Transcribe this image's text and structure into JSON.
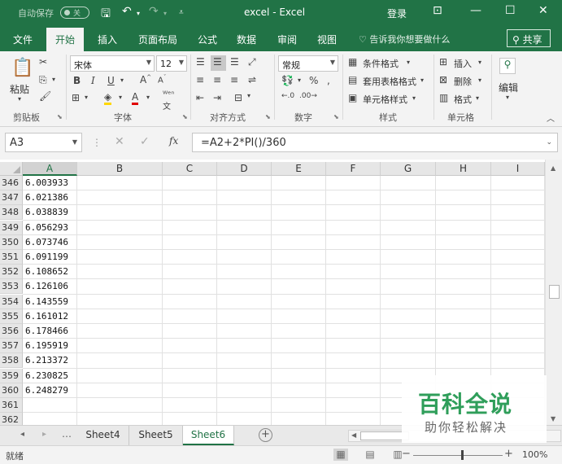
{
  "titlebar": {
    "autosave_label": "自动保存",
    "autosave_state": "关",
    "title": "excel  -  Excel",
    "login": "登录"
  },
  "tabs": [
    "文件",
    "开始",
    "插入",
    "页面布局",
    "公式",
    "数据",
    "审阅",
    "视图"
  ],
  "active_tab": "开始",
  "tellme": "告诉我你想要做什么",
  "share": "共享",
  "ribbon": {
    "paste": "粘贴",
    "clipboard": "剪贴板",
    "font_name": "宋体",
    "font_size": "12",
    "font_group": "字体",
    "align_group": "对齐方式",
    "number_format": "常规",
    "number_group": "数字",
    "cond_format": "条件格式",
    "table_format": "套用表格格式",
    "cell_style": "单元格样式",
    "style_group": "样式",
    "insert": "插入",
    "delete": "删除",
    "format": "格式",
    "cells_group": "单元格",
    "edit": "编辑"
  },
  "formula_bar": {
    "name_box": "A3",
    "formula": "=A2+2*PI()/360"
  },
  "columns": [
    "A",
    "B",
    "C",
    "D",
    "E",
    "F",
    "G",
    "H",
    "I"
  ],
  "rows": [
    {
      "n": "346",
      "a": "6.003933"
    },
    {
      "n": "347",
      "a": "6.021386"
    },
    {
      "n": "348",
      "a": "6.038839"
    },
    {
      "n": "349",
      "a": "6.056293"
    },
    {
      "n": "350",
      "a": "6.073746"
    },
    {
      "n": "351",
      "a": "6.091199"
    },
    {
      "n": "352",
      "a": "6.108652"
    },
    {
      "n": "353",
      "a": "6.126106"
    },
    {
      "n": "354",
      "a": "6.143559"
    },
    {
      "n": "355",
      "a": "6.161012"
    },
    {
      "n": "356",
      "a": "6.178466"
    },
    {
      "n": "357",
      "a": "6.195919"
    },
    {
      "n": "358",
      "a": "6.213372"
    },
    {
      "n": "359",
      "a": "6.230825"
    },
    {
      "n": "360",
      "a": "6.248279"
    },
    {
      "n": "361",
      "a": ""
    },
    {
      "n": "362",
      "a": ""
    }
  ],
  "sheets": [
    "Sheet4",
    "Sheet5",
    "Sheet6"
  ],
  "active_sheet": "Sheet6",
  "status": {
    "ready": "就绪",
    "zoom": "100%"
  },
  "watermark": {
    "title": "百科全说",
    "subtitle": "助你轻松解决"
  },
  "colors": {
    "brand": "#217346",
    "watermark": "#2f9e5a"
  }
}
